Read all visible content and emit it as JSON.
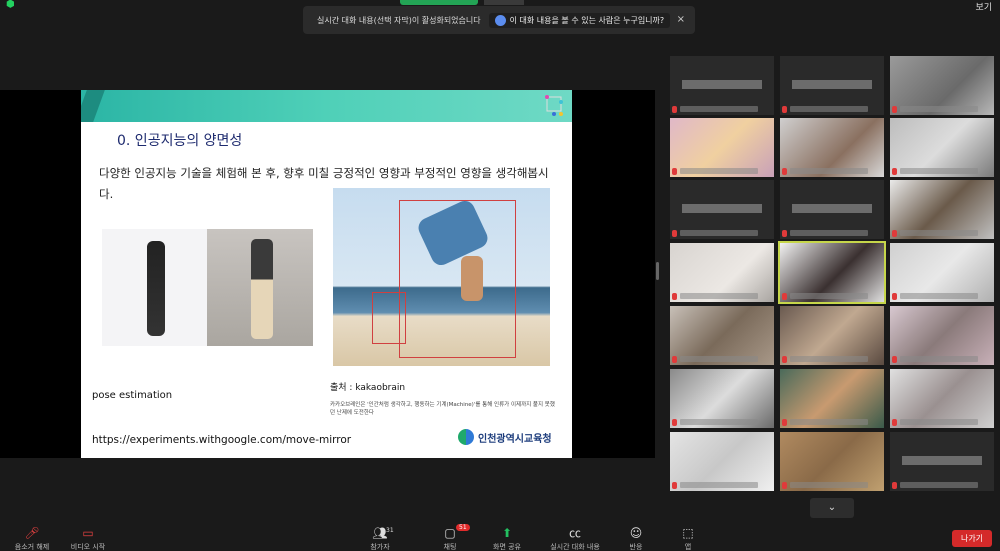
{
  "topbar": {
    "view_label": "보기"
  },
  "banner": {
    "message": "실시간 대화 내용(선택 자막)이 활성화되었습니다",
    "question": "이 대화 내용을 볼 수 있는 사람은 누구입니까?",
    "close_icon": "×"
  },
  "slide": {
    "title": "0. 인공지능의 양면성",
    "description": "다양한 인공지능 기술을 체험해 본 후, 향후 미칠 긍정적인 영향과 부정적인 영향을 생각해봅시다.",
    "caption_pose": "pose estimation",
    "source": "출처 : kakaobrain",
    "note": "카카오브레인은 '인간처럼 생각하고, 행동하는 기계(Machine)'를 통해 인류가 이제까지 풀지 못했던 난제에 도전한다",
    "url": "https://experiments.withgoogle.com/move-mirror",
    "org": "인천광역시교육청"
  },
  "gallery": {
    "more_icon": "⌄"
  },
  "toolbar": {
    "mute_label": "음소거 해제",
    "video_label": "비디오 시작",
    "participants_label": "참가자",
    "participants_count": "31",
    "chat_label": "채팅",
    "chat_badge": "51",
    "share_label": "화면 공유",
    "captions_label": "실시간 대화 내용",
    "reactions_label": "반응",
    "apps_label": "앱",
    "leave_label": "나가기"
  },
  "colors": {
    "accent_green": "#23a455",
    "leave_red": "#d42a2a",
    "slide_teal": "#2bb5a5"
  }
}
